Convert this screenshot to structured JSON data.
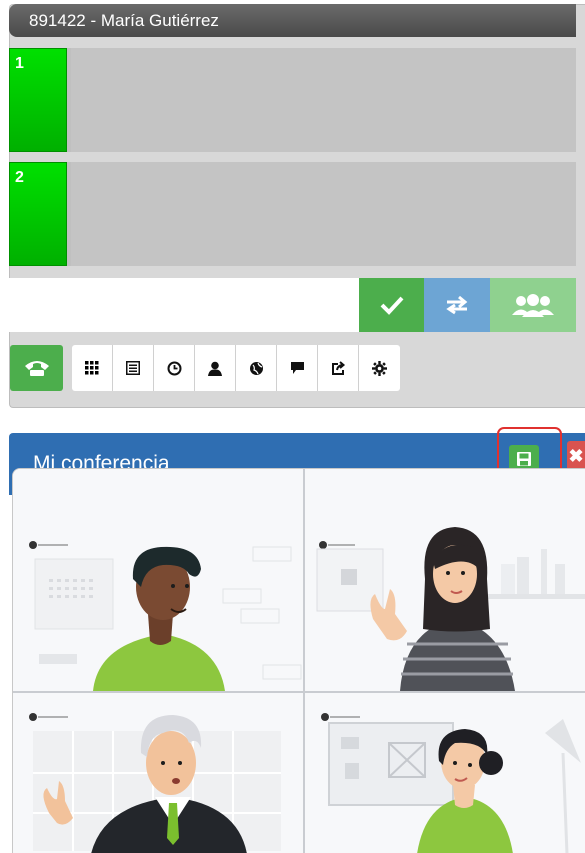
{
  "softphone": {
    "title": "891422 - María Gutiérrez",
    "lines": [
      {
        "label": "1",
        "status_color": "#00c000"
      },
      {
        "label": "2",
        "status_color": "#00c000"
      }
    ],
    "dial_input": {
      "value": "",
      "placeholder": ""
    },
    "action_buttons": [
      {
        "icon": "checkmark-icon",
        "color": "#4cae4c"
      },
      {
        "icon": "transfer-arrows-icon",
        "color": "#6da5d4"
      },
      {
        "icon": "conference-users-icon",
        "color": "#8fd18f"
      }
    ],
    "call_button": {
      "icon": "phone-icon",
      "color": "#4cae4c"
    },
    "toolbar": [
      "keypad-icon",
      "list-icon",
      "clock-icon",
      "contact-icon",
      "globe-icon",
      "chat-icon",
      "forward-icon",
      "gear-icon"
    ]
  },
  "conference": {
    "title": "Mi conferencia",
    "header_color": "#2f6eb2",
    "save_button": {
      "icon": "save-icon",
      "color": "#4cae4c"
    },
    "close_button": {
      "icon": "close-icon",
      "color": "#d9534f"
    },
    "participants": [
      {
        "tile": 1,
        "avatar": "man-dark-hair-green-shirt"
      },
      {
        "tile": 2,
        "avatar": "woman-waving-striped-shirt"
      },
      {
        "tile": 3,
        "avatar": "older-man-suit"
      },
      {
        "tile": 4,
        "avatar": "woman-bun-green-shirt"
      }
    ]
  }
}
